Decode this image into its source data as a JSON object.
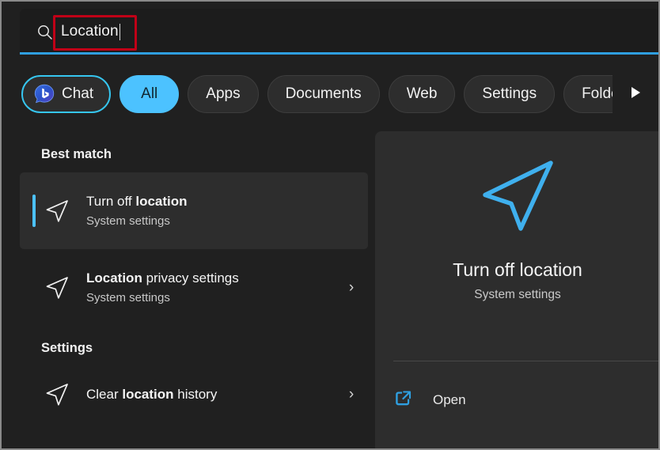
{
  "search": {
    "icon": "search-icon",
    "value": "Location",
    "caret_visible": true,
    "accent_underline_color": "#2f9fe0",
    "annotation_box_color": "#c00017"
  },
  "tabs": [
    {
      "label": "Chat",
      "icon": "bing-chat-icon",
      "state": "outlined"
    },
    {
      "label": "All",
      "icon": null,
      "state": "selected"
    },
    {
      "label": "Apps",
      "icon": null,
      "state": "normal"
    },
    {
      "label": "Documents",
      "icon": null,
      "state": "normal"
    },
    {
      "label": "Web",
      "icon": null,
      "state": "normal"
    },
    {
      "label": "Settings",
      "icon": null,
      "state": "normal"
    },
    {
      "label": "Folders",
      "icon": null,
      "state": "normal-clipped"
    }
  ],
  "tabs_scroll_next": "scroll-right-arrow",
  "results": {
    "best_match": {
      "heading": "Best match",
      "item": {
        "icon": "location-arrow-icon",
        "title_prefix": "Turn off ",
        "title_match": "location",
        "title_suffix": "",
        "subtitle": "System settings",
        "selected": true
      }
    },
    "other": [
      {
        "icon": "location-arrow-icon",
        "title_prefix": "",
        "title_match": "Location",
        "title_suffix": " privacy settings",
        "subtitle": "System settings",
        "chevron": "›"
      }
    ],
    "settings": {
      "heading": "Settings",
      "items": [
        {
          "icon": "location-arrow-icon",
          "title_prefix": "Clear ",
          "title_match": "location",
          "title_suffix": " history",
          "subtitle": "",
          "chevron": "›"
        }
      ]
    }
  },
  "preview": {
    "icon": "location-arrow-icon-large",
    "title": "Turn off location",
    "subtitle": "System settings",
    "actions": [
      {
        "icon": "open-external-icon",
        "label": "Open"
      }
    ]
  },
  "colors": {
    "accent_blue": "#4cc2ff",
    "underline_blue": "#2f9fe0",
    "annotation_red": "#c00017",
    "window_bg": "#202020",
    "panel_bg": "#2d2d2d"
  }
}
